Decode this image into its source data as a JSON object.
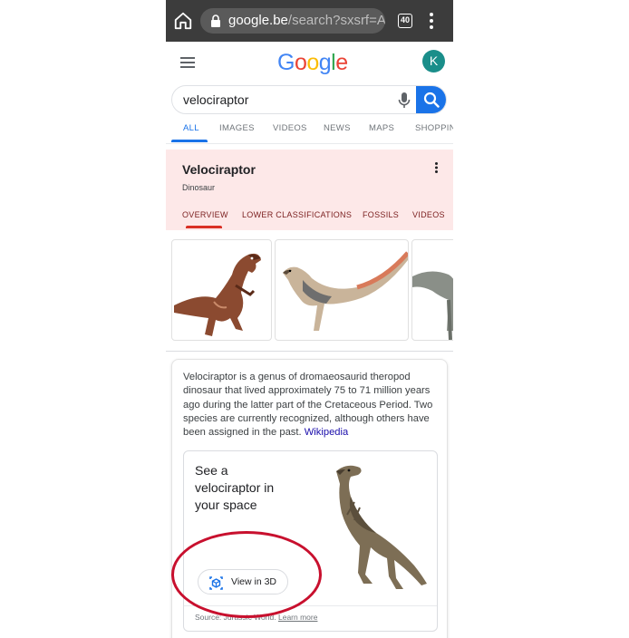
{
  "browser": {
    "url_host": "google.be",
    "url_rest": "/search?sxsrf=AL",
    "tab_count": "40"
  },
  "header": {
    "logo_text": "Google",
    "avatar_letter": "K"
  },
  "search": {
    "query": "velociraptor"
  },
  "nav_tabs": [
    {
      "label": "ALL",
      "active": true
    },
    {
      "label": "IMAGES",
      "active": false
    },
    {
      "label": "VIDEOS",
      "active": false
    },
    {
      "label": "NEWS",
      "active": false
    },
    {
      "label": "MAPS",
      "active": false
    },
    {
      "label": "SHOPPIN",
      "active": false
    }
  ],
  "knowledge_panel": {
    "title": "Velociraptor",
    "subtitle": "Dinosaur",
    "tabs": [
      {
        "label": "OVERVIEW",
        "active": true
      },
      {
        "label": "LOWER CLASSIFICATIONS",
        "active": false
      },
      {
        "label": "FOSSILS",
        "active": false
      },
      {
        "label": "VIDEOS",
        "active": false
      }
    ]
  },
  "description": {
    "text": "Velociraptor is a genus of dromaeosaurid theropod dinosaur that lived approximately 75 to 71 million years ago during the latter part of the Cretaceous Period. Two species are currently recognized, although others have been assigned in the past.",
    "link_label": "Wikipedia"
  },
  "card_3d": {
    "title": "See a velociraptor in your space",
    "button_label": "View in 3D",
    "source_label": "Source: Jurassic World.",
    "learn_more": "Learn more"
  },
  "colors": {
    "browser_bar": "#3c3c3c",
    "accent_blue": "#1a73e8",
    "panel_pink": "#fde8e8",
    "annotation_red": "#c8102e"
  }
}
